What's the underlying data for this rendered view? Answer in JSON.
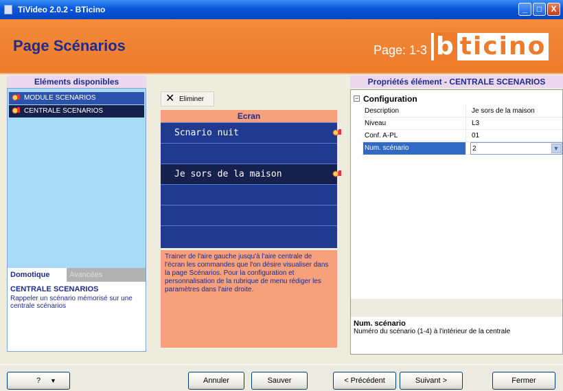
{
  "window": {
    "title": "TiVideo 2.0.2 - BTicino",
    "min_glyph": "_",
    "max_glyph": "□",
    "close_glyph": "X"
  },
  "header": {
    "title": "Page Scénarios",
    "page_label": "Page: 1-3",
    "brand": "bticino"
  },
  "left": {
    "title": "Eléments disponibles",
    "items": [
      {
        "label": "MODULE SCENARIOS",
        "icon": "lamp-icon"
      },
      {
        "label": "CENTRALE SCENARIOS",
        "icon": "lamp-icon"
      }
    ],
    "tabs": {
      "active": "Domotique",
      "inactive": "Avancées"
    },
    "desc_title": "CENTRALE SCENARIOS",
    "desc_text": "Rappeler un scénario mémorisé sur une centrale scénarios"
  },
  "middle": {
    "delete_label": "Eliminer",
    "delete_icon": "x-icon",
    "screen_title": "Ecran",
    "rows": [
      "Scnario nuit",
      "",
      "Je sors de la maison",
      "",
      "",
      ""
    ],
    "help": "Trainer de l'aire gauche jusqu'à l'aire centrale de l'écran les commandes que l'on désire visualiser dans la page Scénarios. Pour la configuration et personnalisation de la rubrique de menu rédiger les paramètres dans l'aire droite."
  },
  "right": {
    "title": "Propriétés élément - CENTRALE SCENARIOS",
    "group": "Configuration",
    "properties": [
      {
        "key": "Description",
        "value": "Je sors de la maison"
      },
      {
        "key": "Niveau",
        "value": "L3"
      },
      {
        "key": "Conf. A-PL",
        "value": "01"
      },
      {
        "key": "Num. scénario",
        "value": "2"
      }
    ],
    "desc_title": "Num. scénario",
    "desc_text": "Numéro du scénario (1-4) à l'intérieur de la centrale"
  },
  "footer": {
    "help": "?",
    "cancel": "Annuler",
    "save": "Sauver",
    "prev": "< Précédent",
    "next": "Suivant >",
    "close": "Fermer"
  },
  "colors": {
    "accent": "#ee7a2b",
    "navy": "#1f2b8a",
    "screen": "#1f3a8e"
  }
}
